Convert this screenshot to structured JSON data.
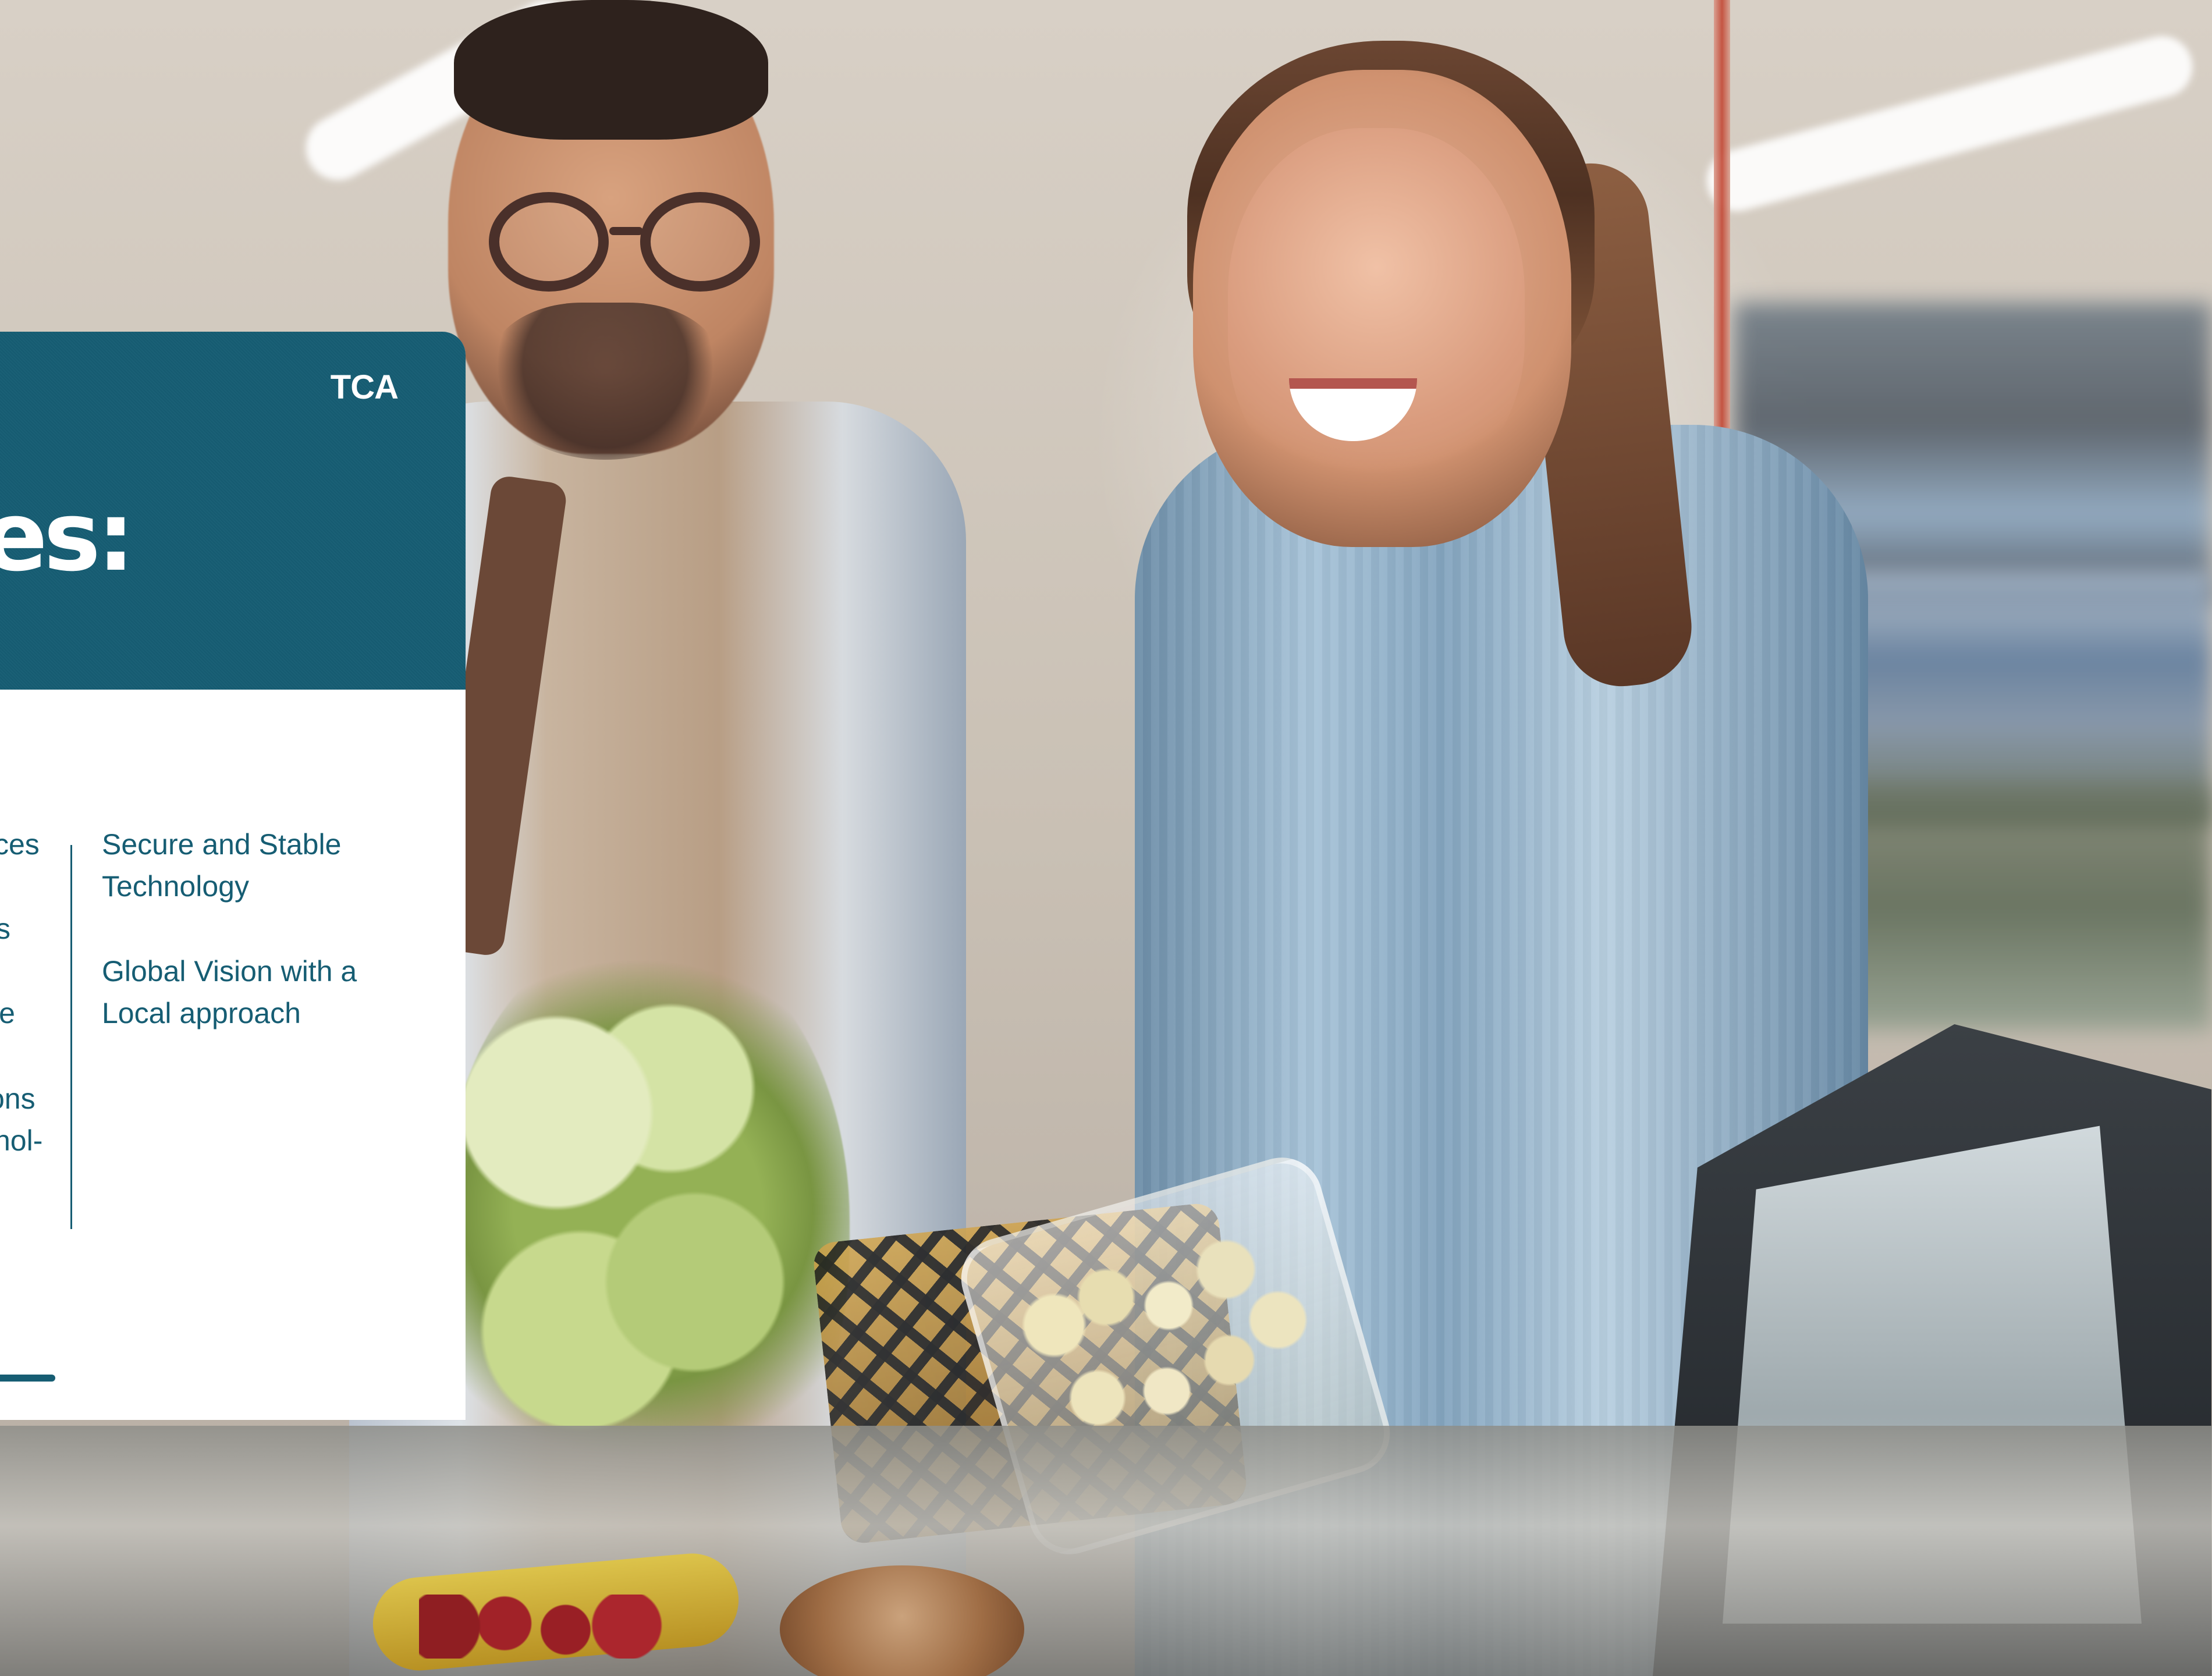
{
  "card": {
    "logo": "TCA",
    "headline": "es:",
    "left_fragments": [
      "ces",
      "s",
      "le",
      "ons",
      "hol-"
    ],
    "right_items": [
      {
        "line_1": "Secure and Stable",
        "line_2": "Technology"
      },
      {
        "line_1": "Global Vision with a",
        "line_2": "Local approach"
      }
    ]
  },
  "colors": {
    "brand_teal": "#165D73",
    "white": "#FFFFFF"
  }
}
